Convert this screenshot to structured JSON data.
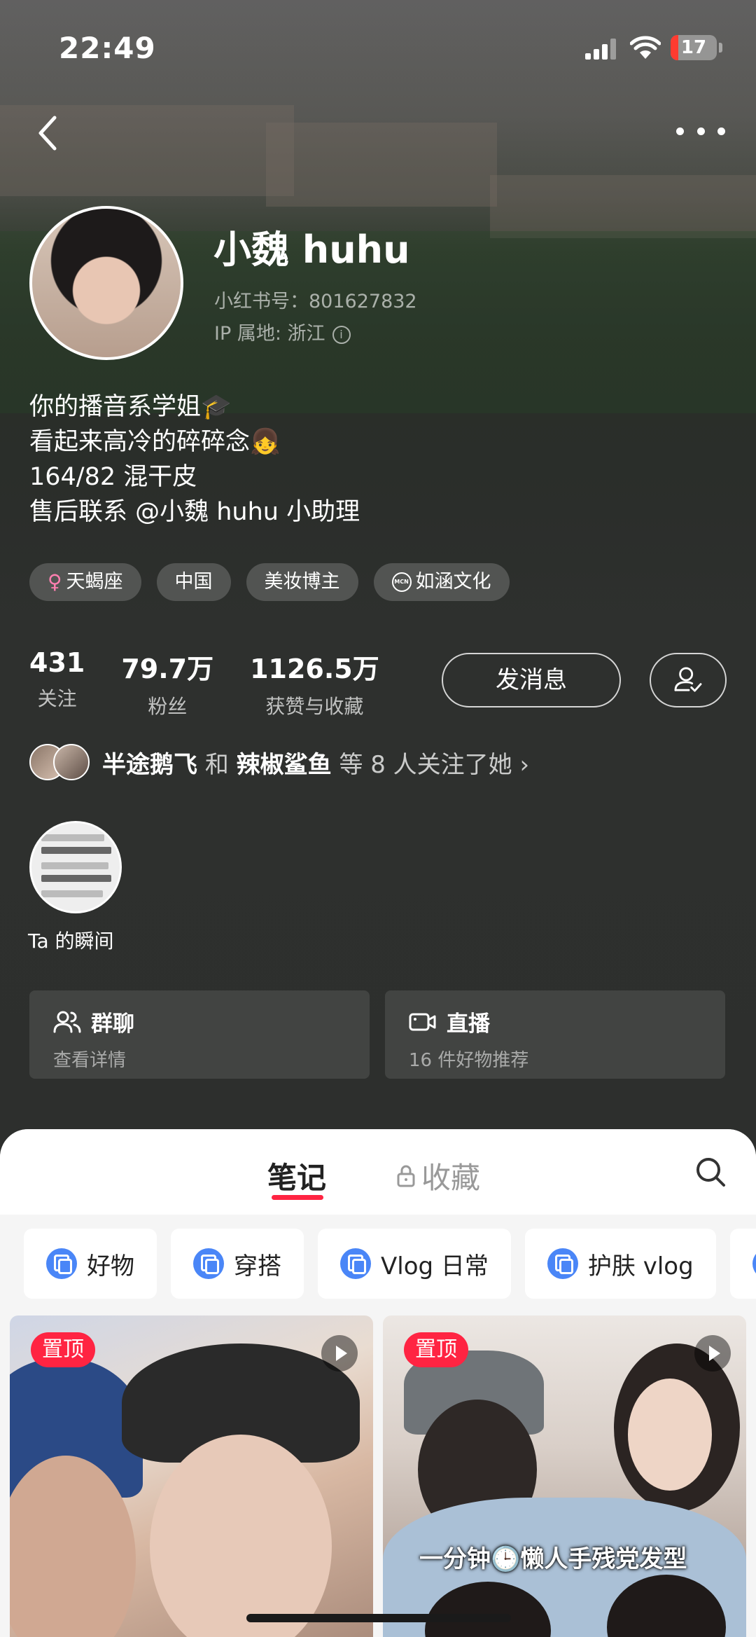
{
  "status_bar": {
    "time": "22:49",
    "battery": "17",
    "battery_level": 0.17
  },
  "profile": {
    "nickname": "小魏 huhu",
    "red_id": "小红书号：801627832",
    "ip": "IP 属地: 浙江",
    "bio": [
      "你的播音系学姐🎓",
      "看起来高冷的碎碎念👧",
      "164/82 混干皮",
      "售后联系 @小魏 huhu 小助理"
    ],
    "tags": [
      {
        "label": "天蝎座",
        "icon": "female-icon"
      },
      {
        "label": "中国"
      },
      {
        "label": "美妆博主"
      },
      {
        "label": "如涵文化",
        "icon": "mcn-icon",
        "icon_text": "MCN"
      }
    ],
    "stats": [
      {
        "value": "431",
        "label": "关注"
      },
      {
        "value": "79.7万",
        "label": "粉丝"
      },
      {
        "value": "1126.5万",
        "label": "获赞与收藏"
      }
    ],
    "message_button": "发消息",
    "mutual": {
      "name1": "半途鹅飞",
      "and": "和",
      "name2": "辣椒鲨鱼",
      "rest": "等 8 人关注了她"
    },
    "moment_label": "Ta 的瞬间",
    "cards": [
      {
        "title": "群聊",
        "subtitle": "查看详情",
        "icon": "group-icon"
      },
      {
        "title": "直播",
        "subtitle": "16 件好物推荐",
        "icon": "live-icon"
      }
    ]
  },
  "sheet": {
    "tab_notes": "笔记",
    "tab_favorites": "收藏",
    "chips": [
      "好物",
      "穿搭",
      "Vlog 日常",
      "护肤 vlog"
    ],
    "posts": [
      {
        "badge": "置顶",
        "caption": ""
      },
      {
        "badge": "置顶",
        "caption": "一分钟🕒懒人手残党发型"
      }
    ]
  }
}
